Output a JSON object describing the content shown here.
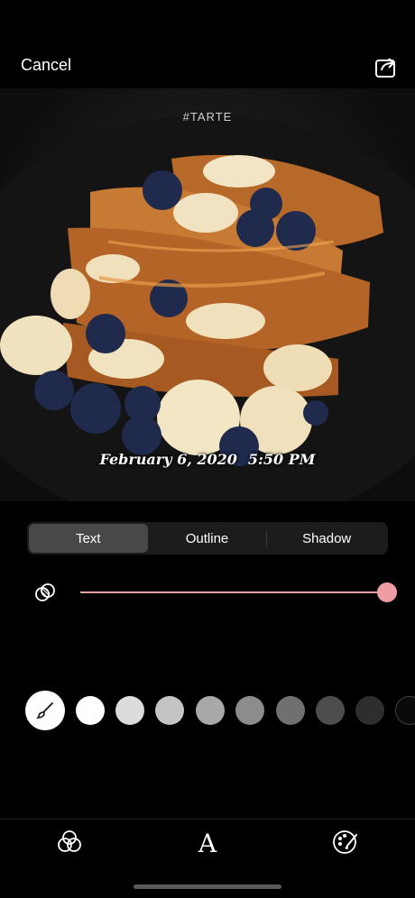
{
  "header": {
    "cancel_label": "Cancel",
    "share_icon": "share-icon"
  },
  "photo": {
    "tag": "#TARTE",
    "date": "February 6, 2020",
    "time": "5:50 PM"
  },
  "tabs": [
    {
      "label": "Text",
      "active": true
    },
    {
      "label": "Outline",
      "active": false
    },
    {
      "label": "Shadow",
      "active": false
    }
  ],
  "opacity": {
    "icon": "opacity-icon",
    "value": 1.0,
    "accent": "#ef9da3"
  },
  "palette": {
    "brush_icon": "brush-icon",
    "colors": [
      "#ffffff",
      "#dcdcdc",
      "#c4c4c4",
      "#a8a8a8",
      "#8c8c8c",
      "#707070",
      "#4d4d4d",
      "#2e2e2e",
      "#0a0a0a"
    ]
  },
  "toolbar": {
    "filters_icon": "filters-icon",
    "text_icon": "text-font-icon",
    "palette_icon": "palette-icon"
  }
}
